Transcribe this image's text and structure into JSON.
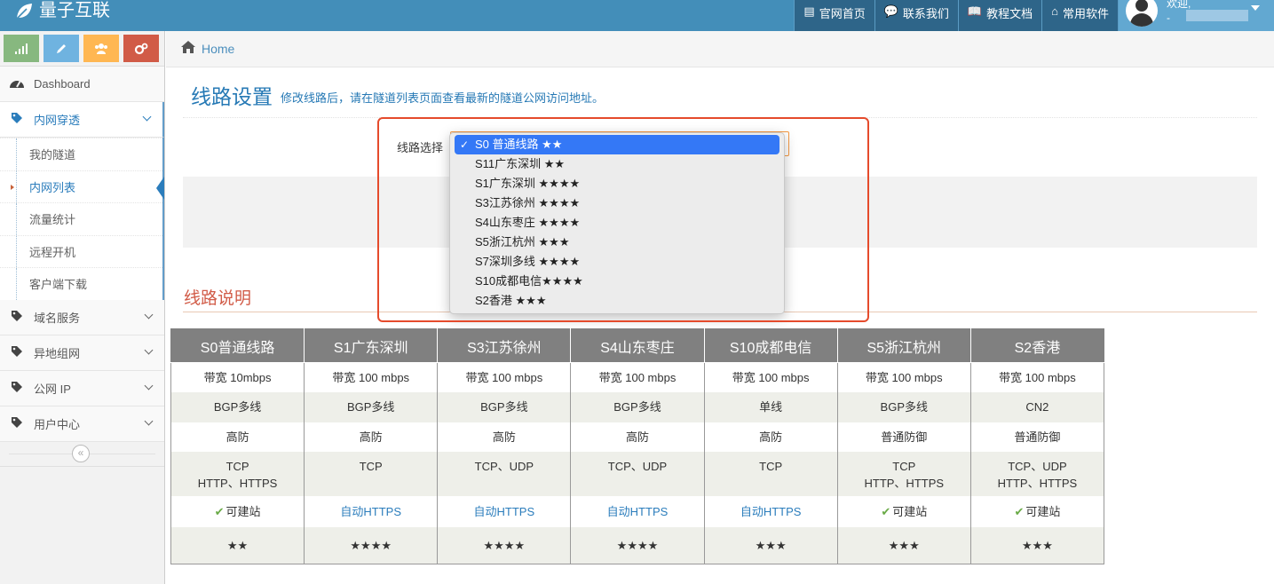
{
  "navbar": {
    "brand": "量子互联",
    "items": [
      {
        "icon": "list-alt-icon",
        "glyph": "▤",
        "label": "官网首页"
      },
      {
        "icon": "comments-icon",
        "glyph": "💬",
        "label": "联系我们"
      },
      {
        "icon": "book-icon",
        "glyph": "📖",
        "label": "教程文档"
      },
      {
        "icon": "hdd-icon",
        "glyph": "⌂",
        "label": "常用软件"
      }
    ],
    "user": {
      "greeting": "欢迎,",
      "name_prefix": "-"
    }
  },
  "sidebar": {
    "items": [
      {
        "label": "Dashboard"
      },
      {
        "label": "内网穿透"
      },
      {
        "label": "域名服务"
      },
      {
        "label": "异地组网"
      },
      {
        "label": "公网 IP"
      },
      {
        "label": "用户中心"
      }
    ],
    "submenu": [
      "我的隧道",
      "内网列表",
      "流量统计",
      "远程开机",
      "客户端下载"
    ],
    "collapse_glyph": "«"
  },
  "breadcrumb": {
    "home": "Home"
  },
  "page_header": {
    "title": "线路设置",
    "subtitle": "修改线路后，请在隧道列表页面查看最新的隧道公网访问地址。"
  },
  "line_select": {
    "label": "线路选择",
    "options": [
      "S0 普通线路 ★★",
      "S11广东深圳 ★★",
      "S1广东深圳 ★★★★",
      "S3江苏徐州 ★★★★",
      "S4山东枣庄 ★★★★",
      "S5浙江杭州 ★★★",
      "S7深圳多线 ★★★★",
      "S10成都电信★★★★",
      "S2香港 ★★★"
    ],
    "selected_index": 0
  },
  "section": {
    "title": "线路说明"
  },
  "table": {
    "headers": [
      "S0普通线路",
      "S1广东深圳",
      "S3江苏徐州",
      "S4山东枣庄",
      "S10成都电信",
      "S5浙江杭州",
      "S2香港"
    ],
    "bandwidth": [
      "带宽 10mbps",
      "带宽 100 mbps",
      "带宽 100 mbps",
      "带宽 100 mbps",
      "带宽 100 mbps",
      "带宽 100 mbps",
      "带宽 100 mbps"
    ],
    "network": [
      "BGP多线",
      "BGP多线",
      "BGP多线",
      "BGP多线",
      "单线",
      "BGP多线",
      "CN2"
    ],
    "defense": [
      "高防",
      "高防",
      "高防",
      "高防",
      "高防",
      "普通防御",
      "普通防御"
    ],
    "protocols_line1": [
      "TCP",
      "TCP",
      "TCP、UDP",
      "TCP、UDP",
      "TCP",
      "TCP",
      "TCP、UDP"
    ],
    "protocols_line2": [
      "HTTP、HTTPS",
      "",
      "",
      "",
      "",
      "HTTP、HTTPS",
      "HTTP、HTTPS"
    ],
    "features": [
      {
        "type": "check",
        "text": "可建站"
      },
      {
        "type": "link",
        "text": "自动HTTPS"
      },
      {
        "type": "link",
        "text": "自动HTTPS"
      },
      {
        "type": "link",
        "text": "自动HTTPS"
      },
      {
        "type": "link",
        "text": "自动HTTPS"
      },
      {
        "type": "check",
        "text": "可建站"
      },
      {
        "type": "check",
        "text": "可建站"
      }
    ],
    "ratings": [
      "★★",
      "★★★★",
      "★★★★",
      "★★★★",
      "★★★",
      "★★★",
      "★★★"
    ]
  },
  "colors": {
    "navbar": "#438eb9",
    "accent": "#2679b5",
    "section_title": "#d15b47",
    "highlight_frame": "#e54b2c",
    "selected_option": "#3478f6"
  }
}
